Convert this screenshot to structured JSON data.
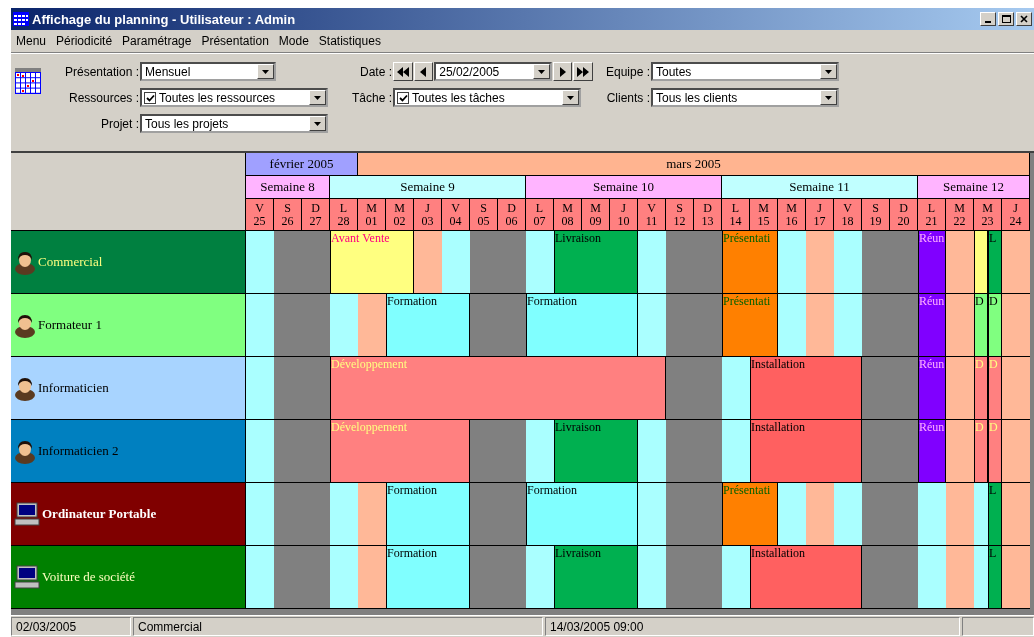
{
  "window": {
    "title": "Affichage du planning - Utilisateur : Admin"
  },
  "menu": [
    "Menu",
    "Périodicité",
    "Paramétrage",
    "Présentation",
    "Mode",
    "Statistiques"
  ],
  "filters": [
    {
      "kind": "short",
      "label": "Présentation :",
      "value": "Mensuel"
    },
    {
      "kind": "date",
      "label": "Date :",
      "value": "25/02/2005"
    },
    {
      "kind": "combo",
      "label": "Equipe :",
      "value": "Toutes"
    },
    {
      "kind": "check",
      "label": "Ressources :",
      "value": "Toutes les ressources",
      "checked": true
    },
    {
      "kind": "check",
      "label": "Tâche :",
      "value": "Toutes les tâches",
      "checked": true
    },
    {
      "kind": "combo",
      "label": "Clients :",
      "value": "Tous les clients"
    },
    {
      "kind": "combo",
      "label": "Projet :",
      "value": "Tous les projets"
    }
  ],
  "planning": {
    "months": [
      {
        "label": "février 2005",
        "color": "#a0a0ff"
      },
      {
        "label": "mars 2005",
        "color": "#ffb490"
      }
    ],
    "weeks": [
      {
        "label": "Semaine 8",
        "color": "#ffb4ff"
      },
      {
        "label": "Semaine 9",
        "color": "#c0ffff"
      },
      {
        "label": "Semaine 10",
        "color": "#ffb4ff"
      },
      {
        "label": "Semaine 11",
        "color": "#c0ffff"
      },
      {
        "label": "Semaine 12",
        "color": "#ffb4ff"
      }
    ],
    "days": [
      {
        "letter": "V",
        "number": "25",
        "kind": "odd"
      },
      {
        "letter": "S",
        "number": "26",
        "kind": "weekend"
      },
      {
        "letter": "D",
        "number": "27",
        "kind": "weekend"
      },
      {
        "letter": "L",
        "number": "28",
        "kind": "odd"
      },
      {
        "letter": "M",
        "number": "01",
        "kind": "even"
      },
      {
        "letter": "M",
        "number": "02"
      },
      {
        "letter": "J",
        "number": "03",
        "kind": "even"
      },
      {
        "letter": "V",
        "number": "04",
        "kind": "odd"
      },
      {
        "letter": "S",
        "number": "05",
        "kind": "weekend"
      },
      {
        "letter": "D",
        "number": "06",
        "kind": "weekend"
      },
      {
        "letter": "L",
        "number": "07",
        "kind": "odd"
      },
      {
        "letter": "M",
        "number": "08"
      },
      {
        "letter": "M",
        "number": "09"
      },
      {
        "letter": "J",
        "number": "10"
      },
      {
        "letter": "V",
        "number": "11",
        "kind": "odd"
      },
      {
        "letter": "S",
        "number": "12",
        "kind": "weekend"
      },
      {
        "letter": "D",
        "number": "13",
        "kind": "weekend"
      },
      {
        "letter": "L",
        "number": "14",
        "kind": "odd"
      },
      {
        "letter": "M",
        "number": "15"
      },
      {
        "letter": "M",
        "number": "16",
        "kind": "odd"
      },
      {
        "letter": "J",
        "number": "17",
        "kind": "even"
      },
      {
        "letter": "V",
        "number": "18",
        "kind": "odd"
      },
      {
        "letter": "S",
        "number": "19",
        "kind": "weekend"
      },
      {
        "letter": "D",
        "number": "20",
        "kind": "weekend"
      },
      {
        "letter": "L",
        "number": "21",
        "kind": "odd"
      },
      {
        "letter": "M",
        "number": "22",
        "kind": "even"
      },
      {
        "letter": "M",
        "number": "23",
        "kind": "odd"
      },
      {
        "letter": "J",
        "number": "24",
        "kind": "even"
      }
    ],
    "rows": [
      {
        "kind": "person",
        "color": "#008040",
        "bold": false,
        "name": {
          "text": "Commercial",
          "color": "#ffff80"
        },
        "tasks": [
          {
            "kind": "sale",
            "color": "#ffff80",
            "label": "Avant Vente"
          },
          {
            "kind": "delivery",
            "color": "#00b050",
            "label": "Livraison"
          },
          {
            "kind": "presentation",
            "color": "#ff8000",
            "label": "Présentati"
          },
          {
            "kind": "meeting",
            "color": "#8000ff",
            "label": "Réun"
          },
          {
            "kind": "sale",
            "color": "#ffff80"
          },
          {
            "kind": "delivery",
            "color": "#00b050",
            "label": "L"
          }
        ]
      },
      {
        "kind": "person",
        "color": "#80ff80",
        "bold": false,
        "name": {
          "text": "Formateur 1",
          "color": "#000000"
        },
        "tasks": [
          {
            "kind": "training",
            "color": "#80ffff",
            "label": "Formation"
          },
          {
            "kind": "training",
            "color": "#80ffff",
            "label": "Formation"
          },
          {
            "kind": "presentation",
            "color": "#ff8000",
            "label": "Présentati"
          },
          {
            "kind": "meeting",
            "color": "#8000ff",
            "label": "Réun"
          },
          {
            "kind": "demo",
            "color": "#80ff80",
            "label": "D"
          },
          {
            "kind": "demo",
            "color": "#80ff80",
            "label": "D"
          }
        ]
      },
      {
        "kind": "person",
        "color": "#a8d4ff",
        "bold": false,
        "name": {
          "text": "Informaticien",
          "color": "#000000"
        },
        "tasks": [
          {
            "kind": "development",
            "color": "#ff8080",
            "label": "Développement"
          },
          {
            "kind": "install",
            "color": "#ff6060",
            "label": "Installation"
          },
          {
            "kind": "meeting",
            "color": "#8000ff",
            "label": "Réun"
          },
          {
            "kind": "development",
            "color": "#ff8080",
            "label": "D"
          },
          {
            "kind": "development",
            "color": "#ff8080",
            "label": "D"
          }
        ]
      },
      {
        "kind": "person",
        "color": "#0080c0",
        "bold": false,
        "name": {
          "text": "Informaticien 2",
          "color": "#000000"
        },
        "tasks": [
          {
            "kind": "development",
            "color": "#ff8080",
            "label": "Développement"
          },
          {
            "kind": "delivery",
            "color": "#00b050",
            "label": "Livraison"
          },
          {
            "kind": "install",
            "color": "#ff6060",
            "label": "Installation"
          },
          {
            "kind": "meeting",
            "color": "#8000ff",
            "label": "Réun"
          },
          {
            "kind": "development",
            "color": "#ff8080",
            "label": "D"
          },
          {
            "kind": "development",
            "color": "#ff8080",
            "label": "D"
          }
        ]
      },
      {
        "kind": "computer",
        "color": "#800000",
        "bold": true,
        "name": {
          "text": "Ordinateur Portable",
          "color": "#ffffff"
        },
        "tasks": [
          {
            "kind": "training",
            "color": "#80ffff",
            "label": "Formation"
          },
          {
            "kind": "training",
            "color": "#80ffff",
            "label": "Formation"
          },
          {
            "kind": "presentation",
            "color": "#ff8000",
            "label": "Présentati"
          },
          {
            "kind": "delivery",
            "color": "#00b050",
            "label": "L"
          }
        ]
      },
      {
        "kind": "computer",
        "color": "#008000",
        "bold": false,
        "name": {
          "text": "Voiture de société",
          "color": "#ffffc0"
        },
        "tasks": [
          {
            "kind": "training",
            "color": "#80ffff",
            "label": "Formation"
          },
          {
            "kind": "delivery",
            "color": "#00b050",
            "label": "Livraison"
          },
          {
            "kind": "install",
            "color": "#ff6060",
            "label": "Installation"
          },
          {
            "kind": "delivery",
            "color": "#00b050",
            "label": "L"
          }
        ]
      }
    ]
  },
  "status_bar": [
    "02/03/2005",
    "Commercial",
    "14/03/2005 09:00"
  ]
}
